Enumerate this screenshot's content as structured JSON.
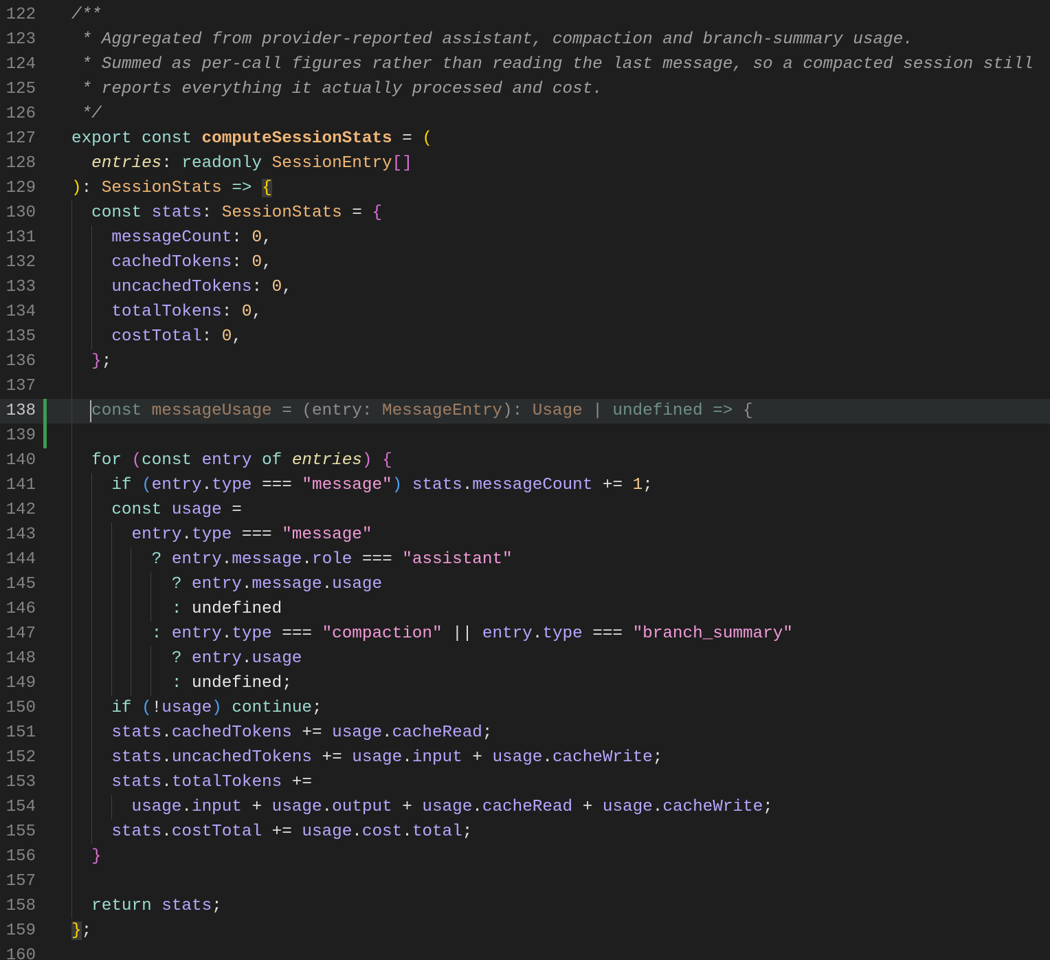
{
  "editor": {
    "current_line": 138,
    "lines": [
      {
        "n": "122",
        "tokens": [
          [
            "t-cmt",
            "/**"
          ]
        ]
      },
      {
        "n": "123",
        "tokens": [
          [
            "t-cmt",
            " * Aggregated from provider-reported assistant, compaction and branch-summary usage."
          ]
        ]
      },
      {
        "n": "124",
        "tokens": [
          [
            "t-cmt",
            " * Summed as per-call figures rather than reading the last message, so a compacted session still"
          ]
        ]
      },
      {
        "n": "125",
        "tokens": [
          [
            "t-cmt",
            " * reports everything it actually processed and cost."
          ]
        ]
      },
      {
        "n": "126",
        "tokens": [
          [
            "t-cmt",
            " */"
          ]
        ]
      },
      {
        "n": "127",
        "tokens": [
          [
            "t-kw",
            "export const "
          ],
          [
            "t-fn",
            "computeSessionStats"
          ],
          [
            "t-op",
            " = "
          ],
          [
            "t-p1",
            "("
          ]
        ]
      },
      {
        "n": "128",
        "tokens": [
          [
            "t-pl",
            "  "
          ],
          [
            "t-par",
            "entries"
          ],
          [
            "t-op",
            ": "
          ],
          [
            "t-kw",
            "readonly "
          ],
          [
            "t-ty",
            "SessionEntry"
          ],
          [
            "t-p2",
            "[]"
          ]
        ]
      },
      {
        "n": "129",
        "tokens": [
          [
            "t-p1",
            ")"
          ],
          [
            "t-op",
            ": "
          ],
          [
            "t-ty",
            "SessionStats"
          ],
          [
            "t-kw",
            " => "
          ],
          [
            "t-p1 bracket-match",
            "{"
          ]
        ]
      },
      {
        "n": "130",
        "tokens": [
          [
            "t-pl",
            "  "
          ],
          [
            "t-kw",
            "const "
          ],
          [
            "t-var",
            "stats"
          ],
          [
            "t-op",
            ": "
          ],
          [
            "t-ty",
            "SessionStats"
          ],
          [
            "t-op",
            " = "
          ],
          [
            "t-p2",
            "{"
          ]
        ]
      },
      {
        "n": "131",
        "tokens": [
          [
            "t-pl",
            "    "
          ],
          [
            "t-prop",
            "messageCount"
          ],
          [
            "t-op",
            ": "
          ],
          [
            "t-num",
            "0"
          ],
          [
            "t-op",
            ","
          ]
        ]
      },
      {
        "n": "132",
        "tokens": [
          [
            "t-pl",
            "    "
          ],
          [
            "t-prop",
            "cachedTokens"
          ],
          [
            "t-op",
            ": "
          ],
          [
            "t-num",
            "0"
          ],
          [
            "t-op",
            ","
          ]
        ]
      },
      {
        "n": "133",
        "tokens": [
          [
            "t-pl",
            "    "
          ],
          [
            "t-prop",
            "uncachedTokens"
          ],
          [
            "t-op",
            ": "
          ],
          [
            "t-num",
            "0"
          ],
          [
            "t-op",
            ","
          ]
        ]
      },
      {
        "n": "134",
        "tokens": [
          [
            "t-pl",
            "    "
          ],
          [
            "t-prop",
            "totalTokens"
          ],
          [
            "t-op",
            ": "
          ],
          [
            "t-num",
            "0"
          ],
          [
            "t-op",
            ","
          ]
        ]
      },
      {
        "n": "135",
        "tokens": [
          [
            "t-pl",
            "    "
          ],
          [
            "t-prop",
            "costTotal"
          ],
          [
            "t-op",
            ": "
          ],
          [
            "t-num",
            "0"
          ],
          [
            "t-op",
            ","
          ]
        ]
      },
      {
        "n": "136",
        "tokens": [
          [
            "t-pl",
            "  "
          ],
          [
            "t-p2",
            "}"
          ],
          [
            "t-op",
            ";"
          ]
        ]
      },
      {
        "n": "137",
        "tokens": []
      },
      {
        "n": "138",
        "tokens": [
          [
            "t-pl",
            "  "
          ],
          [
            "t-ghost-kw",
            "const "
          ],
          [
            "t-ghost-ty",
            "messageUsage"
          ],
          [
            "t-ghost",
            " = (entry: "
          ],
          [
            "t-ghost-ty",
            "MessageEntry"
          ],
          [
            "t-ghost",
            "): "
          ],
          [
            "t-ghost-ty",
            "Usage"
          ],
          [
            "t-ghost",
            " | "
          ],
          [
            "t-ghost-kw",
            "undefined"
          ],
          [
            "t-ghost-kw",
            " => "
          ],
          [
            "t-ghost",
            "{"
          ]
        ]
      },
      {
        "n": "139",
        "tokens": []
      },
      {
        "n": "140",
        "tokens": [
          [
            "t-pl",
            "  "
          ],
          [
            "t-kw",
            "for "
          ],
          [
            "t-p2",
            "("
          ],
          [
            "t-kw",
            "const "
          ],
          [
            "t-var",
            "entry"
          ],
          [
            "t-kw",
            " of "
          ],
          [
            "t-par",
            "entries"
          ],
          [
            "t-p2",
            ")"
          ],
          [
            "t-op",
            " "
          ],
          [
            "t-p2",
            "{"
          ]
        ]
      },
      {
        "n": "141",
        "tokens": [
          [
            "t-pl",
            "    "
          ],
          [
            "t-kw",
            "if "
          ],
          [
            "t-p3",
            "("
          ],
          [
            "t-var",
            "entry"
          ],
          [
            "t-op",
            "."
          ],
          [
            "t-prop",
            "type"
          ],
          [
            "t-op",
            " === "
          ],
          [
            "t-str",
            "\"message\""
          ],
          [
            "t-p3",
            ")"
          ],
          [
            "t-op",
            " "
          ],
          [
            "t-var",
            "stats"
          ],
          [
            "t-op",
            "."
          ],
          [
            "t-prop",
            "messageCount"
          ],
          [
            "t-op",
            " += "
          ],
          [
            "t-num",
            "1"
          ],
          [
            "t-op",
            ";"
          ]
        ]
      },
      {
        "n": "142",
        "tokens": [
          [
            "t-pl",
            "    "
          ],
          [
            "t-kw",
            "const "
          ],
          [
            "t-var",
            "usage"
          ],
          [
            "t-op",
            " ="
          ]
        ]
      },
      {
        "n": "143",
        "tokens": [
          [
            "t-pl",
            "      "
          ],
          [
            "t-var",
            "entry"
          ],
          [
            "t-op",
            "."
          ],
          [
            "t-prop",
            "type"
          ],
          [
            "t-op",
            " === "
          ],
          [
            "t-str",
            "\"message\""
          ]
        ]
      },
      {
        "n": "144",
        "tokens": [
          [
            "t-pl",
            "        "
          ],
          [
            "t-kw",
            "? "
          ],
          [
            "t-var",
            "entry"
          ],
          [
            "t-op",
            "."
          ],
          [
            "t-prop",
            "message"
          ],
          [
            "t-op",
            "."
          ],
          [
            "t-prop",
            "role"
          ],
          [
            "t-op",
            " === "
          ],
          [
            "t-str",
            "\"assistant\""
          ]
        ]
      },
      {
        "n": "145",
        "tokens": [
          [
            "t-pl",
            "          "
          ],
          [
            "t-kw",
            "? "
          ],
          [
            "t-var",
            "entry"
          ],
          [
            "t-op",
            "."
          ],
          [
            "t-prop",
            "message"
          ],
          [
            "t-op",
            "."
          ],
          [
            "t-prop",
            "usage"
          ]
        ]
      },
      {
        "n": "146",
        "tokens": [
          [
            "t-pl",
            "          "
          ],
          [
            "t-kw",
            ": "
          ],
          [
            "t-pl",
            "undefined"
          ]
        ]
      },
      {
        "n": "147",
        "tokens": [
          [
            "t-pl",
            "        "
          ],
          [
            "t-kw",
            ": "
          ],
          [
            "t-var",
            "entry"
          ],
          [
            "t-op",
            "."
          ],
          [
            "t-prop",
            "type"
          ],
          [
            "t-op",
            " === "
          ],
          [
            "t-str",
            "\"compaction\""
          ],
          [
            "t-op",
            " || "
          ],
          [
            "t-var",
            "entry"
          ],
          [
            "t-op",
            "."
          ],
          [
            "t-prop",
            "type"
          ],
          [
            "t-op",
            " === "
          ],
          [
            "t-str",
            "\"branch_summary\""
          ]
        ]
      },
      {
        "n": "148",
        "tokens": [
          [
            "t-pl",
            "          "
          ],
          [
            "t-kw",
            "? "
          ],
          [
            "t-var",
            "entry"
          ],
          [
            "t-op",
            "."
          ],
          [
            "t-prop",
            "usage"
          ]
        ]
      },
      {
        "n": "149",
        "tokens": [
          [
            "t-pl",
            "          "
          ],
          [
            "t-kw",
            ": "
          ],
          [
            "t-pl",
            "undefined"
          ],
          [
            "t-op",
            ";"
          ]
        ]
      },
      {
        "n": "150",
        "tokens": [
          [
            "t-pl",
            "    "
          ],
          [
            "t-kw",
            "if "
          ],
          [
            "t-p3",
            "("
          ],
          [
            "t-op",
            "!"
          ],
          [
            "t-var",
            "usage"
          ],
          [
            "t-p3",
            ")"
          ],
          [
            "t-kw",
            " continue"
          ],
          [
            "t-op",
            ";"
          ]
        ]
      },
      {
        "n": "151",
        "tokens": [
          [
            "t-pl",
            "    "
          ],
          [
            "t-var",
            "stats"
          ],
          [
            "t-op",
            "."
          ],
          [
            "t-prop",
            "cachedTokens"
          ],
          [
            "t-op",
            " += "
          ],
          [
            "t-var",
            "usage"
          ],
          [
            "t-op",
            "."
          ],
          [
            "t-prop",
            "cacheRead"
          ],
          [
            "t-op",
            ";"
          ]
        ]
      },
      {
        "n": "152",
        "tokens": [
          [
            "t-pl",
            "    "
          ],
          [
            "t-var",
            "stats"
          ],
          [
            "t-op",
            "."
          ],
          [
            "t-prop",
            "uncachedTokens"
          ],
          [
            "t-op",
            " += "
          ],
          [
            "t-var",
            "usage"
          ],
          [
            "t-op",
            "."
          ],
          [
            "t-prop",
            "input"
          ],
          [
            "t-op",
            " + "
          ],
          [
            "t-var",
            "usage"
          ],
          [
            "t-op",
            "."
          ],
          [
            "t-prop",
            "cacheWrite"
          ],
          [
            "t-op",
            ";"
          ]
        ]
      },
      {
        "n": "153",
        "tokens": [
          [
            "t-pl",
            "    "
          ],
          [
            "t-var",
            "stats"
          ],
          [
            "t-op",
            "."
          ],
          [
            "t-prop",
            "totalTokens"
          ],
          [
            "t-op",
            " +="
          ]
        ]
      },
      {
        "n": "154",
        "tokens": [
          [
            "t-pl",
            "      "
          ],
          [
            "t-var",
            "usage"
          ],
          [
            "t-op",
            "."
          ],
          [
            "t-prop",
            "input"
          ],
          [
            "t-op",
            " + "
          ],
          [
            "t-var",
            "usage"
          ],
          [
            "t-op",
            "."
          ],
          [
            "t-prop",
            "output"
          ],
          [
            "t-op",
            " + "
          ],
          [
            "t-var",
            "usage"
          ],
          [
            "t-op",
            "."
          ],
          [
            "t-prop",
            "cacheRead"
          ],
          [
            "t-op",
            " + "
          ],
          [
            "t-var",
            "usage"
          ],
          [
            "t-op",
            "."
          ],
          [
            "t-prop",
            "cacheWrite"
          ],
          [
            "t-op",
            ";"
          ]
        ]
      },
      {
        "n": "155",
        "tokens": [
          [
            "t-pl",
            "    "
          ],
          [
            "t-var",
            "stats"
          ],
          [
            "t-op",
            "."
          ],
          [
            "t-prop",
            "costTotal"
          ],
          [
            "t-op",
            " += "
          ],
          [
            "t-var",
            "usage"
          ],
          [
            "t-op",
            "."
          ],
          [
            "t-prop",
            "cost"
          ],
          [
            "t-op",
            "."
          ],
          [
            "t-prop",
            "total"
          ],
          [
            "t-op",
            ";"
          ]
        ]
      },
      {
        "n": "156",
        "tokens": [
          [
            "t-pl",
            "  "
          ],
          [
            "t-p2",
            "}"
          ]
        ]
      },
      {
        "n": "157",
        "tokens": []
      },
      {
        "n": "158",
        "tokens": [
          [
            "t-pl",
            "  "
          ],
          [
            "t-kw",
            "return "
          ],
          [
            "t-var",
            "stats"
          ],
          [
            "t-op",
            ";"
          ]
        ]
      },
      {
        "n": "159",
        "tokens": [
          [
            "t-p1 bracket-match",
            "}"
          ],
          [
            "t-op",
            ";"
          ]
        ]
      },
      {
        "n": "160",
        "tokens": []
      }
    ]
  }
}
